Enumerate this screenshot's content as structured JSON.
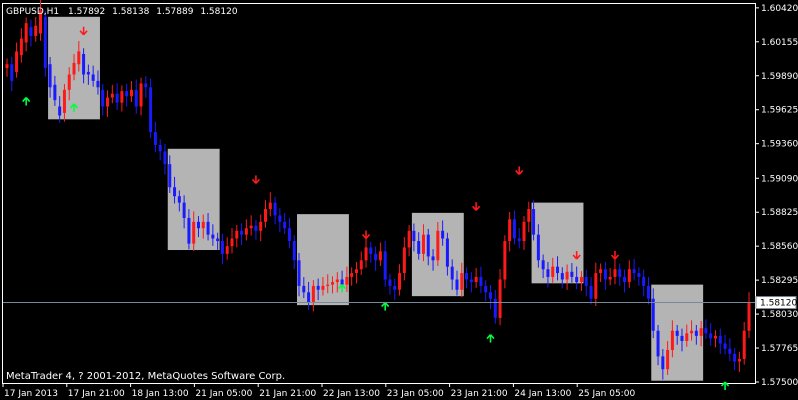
{
  "header": {
    "symbol": "GBPUSD,H1",
    "open": "1.57892",
    "high": "1.58138",
    "low": "1.57889",
    "close": "1.58120"
  },
  "copyright": "MetaTrader 4, ? 2001-2012, MetaQuotes Software Corp.",
  "colors": {
    "background": "#000000",
    "frame": "#ffffff",
    "bull": "#ff1a1a",
    "bear": "#1a1aff",
    "zone": "#b4b4b4",
    "up_arrow": "#00ff40",
    "down_arrow": "#ff1a1a",
    "price_line": "#778899",
    "text": "#ffffff"
  },
  "chart_data": {
    "type": "candlestick",
    "symbol": "GBPUSD",
    "timeframe": "H1",
    "y_ticks": [
      "1.60420",
      "1.60155",
      "1.59890",
      "1.59625",
      "1.59360",
      "1.59090",
      "1.58825",
      "1.58560",
      "1.58295",
      "1.58030",
      "1.57765",
      "1.57500"
    ],
    "x_ticks": [
      "17 Jan 2013",
      "17 Jan 21:00",
      "18 Jan 13:00",
      "21 Jan 05:00",
      "21 Jan 21:00",
      "22 Jan 13:00",
      "23 Jan 05:00",
      "23 Jan 21:00",
      "24 Jan 13:00",
      "25 Jan 05:00"
    ],
    "current_price": "1.58120",
    "ylim": [
      1.575,
      1.6045
    ],
    "zones": [
      {
        "from": 1.6035,
        "to": 1.5955
      },
      {
        "from": 1.5932,
        "to": 1.5853
      },
      {
        "from": 1.5881,
        "to": 1.581
      },
      {
        "from": 1.5882,
        "to": 1.5817
      },
      {
        "from": 1.589,
        "to": 1.5827
      },
      {
        "from": 1.5826,
        "to": 1.5751
      }
    ],
    "signals": [
      {
        "type": "up",
        "price": 1.5972
      },
      {
        "type": "down",
        "price": 1.6021
      },
      {
        "type": "up",
        "price": 1.5967
      },
      {
        "type": "down",
        "price": 1.5905
      },
      {
        "type": "up",
        "price": 1.5826
      },
      {
        "type": "down",
        "price": 1.5862
      },
      {
        "type": "up",
        "price": 1.5812
      },
      {
        "type": "down",
        "price": 1.5884
      },
      {
        "type": "up",
        "price": 1.5787
      },
      {
        "type": "down",
        "price": 1.5912
      },
      {
        "type": "down",
        "price": 1.5846
      },
      {
        "type": "down",
        "price": 1.5846
      },
      {
        "type": "up",
        "price": 1.575
      }
    ],
    "candles": [
      [
        1.5995,
        1.5998
      ],
      [
        1.5998,
        1.5985
      ],
      [
        1.5992,
        1.6008
      ],
      [
        1.6005,
        1.6018
      ],
      [
        1.6015,
        1.603
      ],
      [
        1.6027,
        1.602
      ],
      [
        1.602,
        1.6028
      ],
      [
        1.6022,
        1.604
      ],
      [
        1.6035,
        1.5995
      ],
      [
        1.5998,
        1.598
      ],
      [
        1.5982,
        1.597
      ],
      [
        1.5965,
        1.5958
      ],
      [
        1.596,
        1.5978
      ],
      [
        1.5978,
        1.599
      ],
      [
        1.599,
        1.5999
      ],
      [
        1.5998,
        1.6008
      ],
      [
        1.6006,
        1.599
      ],
      [
        1.5992,
        1.599
      ],
      [
        1.599,
        1.5985
      ],
      [
        1.5985,
        1.598
      ],
      [
        1.5978,
        1.5965
      ],
      [
        1.5965,
        1.5972
      ],
      [
        1.5972,
        1.5975
      ],
      [
        1.5975,
        1.5968
      ],
      [
        1.5968,
        1.5977
      ],
      [
        1.5977,
        1.5973
      ],
      [
        1.5973,
        1.5978
      ],
      [
        1.5978,
        1.5965
      ],
      [
        1.5965,
        1.5983
      ],
      [
        1.5983,
        1.598
      ],
      [
        1.598,
        1.5945
      ],
      [
        1.5945,
        1.5935
      ],
      [
        1.5935,
        1.593
      ],
      [
        1.593,
        1.592
      ],
      [
        1.592,
        1.5902
      ],
      [
        1.5902,
        1.5895
      ],
      [
        1.5895,
        1.589
      ],
      [
        1.589,
        1.5878
      ],
      [
        1.5878,
        1.5858
      ],
      [
        1.5858,
        1.5875
      ],
      [
        1.5875,
        1.587
      ],
      [
        1.587,
        1.5875
      ],
      [
        1.5875,
        1.5865
      ],
      [
        1.5865,
        1.5862
      ],
      [
        1.5862,
        1.586
      ],
      [
        1.586,
        1.585
      ],
      [
        1.585,
        1.5856
      ],
      [
        1.5856,
        1.5862
      ],
      [
        1.5862,
        1.5868
      ],
      [
        1.5868,
        1.5865
      ],
      [
        1.5865,
        1.587
      ],
      [
        1.587,
        1.5872
      ],
      [
        1.5872,
        1.5868
      ],
      [
        1.5868,
        1.5875
      ],
      [
        1.5875,
        1.5885
      ],
      [
        1.5885,
        1.589
      ],
      [
        1.589,
        1.588
      ],
      [
        1.588,
        1.5875
      ],
      [
        1.5875,
        1.587
      ],
      [
        1.587,
        1.586
      ],
      [
        1.586,
        1.5845
      ],
      [
        1.5845,
        1.5825
      ],
      [
        1.5825,
        1.582
      ],
      [
        1.582,
        1.5812
      ],
      [
        1.5812,
        1.5825
      ],
      [
        1.5825,
        1.5822
      ],
      [
        1.5822,
        1.5825
      ],
      [
        1.5825,
        1.5826
      ],
      [
        1.5826,
        1.5828
      ],
      [
        1.5828,
        1.583
      ],
      [
        1.583,
        1.5826
      ],
      [
        1.5826,
        1.5832
      ],
      [
        1.5832,
        1.5835
      ],
      [
        1.5835,
        1.5838
      ],
      [
        1.5838,
        1.5845
      ],
      [
        1.5845,
        1.5855
      ],
      [
        1.5855,
        1.585
      ],
      [
        1.585,
        1.5845
      ],
      [
        1.5845,
        1.5852
      ],
      [
        1.5852,
        1.583
      ],
      [
        1.583,
        1.5825
      ],
      [
        1.5825,
        1.5822
      ],
      [
        1.5822,
        1.5835
      ],
      [
        1.5835,
        1.5855
      ],
      [
        1.5855,
        1.5868
      ],
      [
        1.5868,
        1.586
      ],
      [
        1.586,
        1.585
      ],
      [
        1.585,
        1.5865
      ],
      [
        1.5865,
        1.5848
      ],
      [
        1.5848,
        1.5845
      ],
      [
        1.5845,
        1.5868
      ],
      [
        1.5868,
        1.5862
      ],
      [
        1.5862,
        1.584
      ],
      [
        1.584,
        1.583
      ],
      [
        1.583,
        1.5822
      ],
      [
        1.5822,
        1.5835
      ],
      [
        1.5835,
        1.583
      ],
      [
        1.583,
        1.5828
      ],
      [
        1.5828,
        1.5832
      ],
      [
        1.5832,
        1.5825
      ],
      [
        1.5825,
        1.582
      ],
      [
        1.582,
        1.5815
      ],
      [
        1.5815,
        1.58
      ],
      [
        1.58,
        1.583
      ],
      [
        1.583,
        1.586
      ],
      [
        1.586,
        1.5877
      ],
      [
        1.5877,
        1.5862
      ],
      [
        1.5862,
        1.586
      ],
      [
        1.586,
        1.5875
      ],
      [
        1.5875,
        1.5885
      ],
      [
        1.5885,
        1.5865
      ],
      [
        1.5865,
        1.5845
      ],
      [
        1.5845,
        1.5838
      ],
      [
        1.5838,
        1.5832
      ],
      [
        1.5832,
        1.584
      ],
      [
        1.584,
        1.5835
      ],
      [
        1.5835,
        1.583
      ],
      [
        1.583,
        1.5836
      ],
      [
        1.5836,
        1.5832
      ],
      [
        1.5832,
        1.5828
      ],
      [
        1.5828,
        1.5832
      ],
      [
        1.5832,
        1.5825
      ],
      [
        1.5825,
        1.5815
      ],
      [
        1.5815,
        1.5835
      ],
      [
        1.5835,
        1.5838
      ],
      [
        1.5838,
        1.583
      ],
      [
        1.583,
        1.5832
      ],
      [
        1.5832,
        1.5838
      ],
      [
        1.5838,
        1.5832
      ],
      [
        1.5832,
        1.5828
      ],
      [
        1.5828,
        1.5838
      ],
      [
        1.5838,
        1.5835
      ],
      [
        1.5835,
        1.5832
      ],
      [
        1.5832,
        1.5825
      ],
      [
        1.5825,
        1.5815
      ],
      [
        1.5815,
        1.579
      ],
      [
        1.579,
        1.577
      ],
      [
        1.577,
        1.576
      ],
      [
        1.576,
        1.5775
      ],
      [
        1.5775,
        1.579
      ],
      [
        1.579,
        1.5786
      ],
      [
        1.5786,
        1.5782
      ],
      [
        1.5782,
        1.5788
      ],
      [
        1.5788,
        1.579
      ],
      [
        1.579,
        1.5786
      ],
      [
        1.5786,
        1.5792
      ],
      [
        1.5792,
        1.5788
      ],
      [
        1.5788,
        1.5784
      ],
      [
        1.5784,
        1.5786
      ],
      [
        1.5786,
        1.578
      ],
      [
        1.578,
        1.5776
      ],
      [
        1.5776,
        1.5772
      ],
      [
        1.5772,
        1.5766
      ],
      [
        1.5766,
        1.5768
      ],
      [
        1.5768,
        1.579
      ],
      [
        1.579,
        1.5812
      ]
    ]
  }
}
